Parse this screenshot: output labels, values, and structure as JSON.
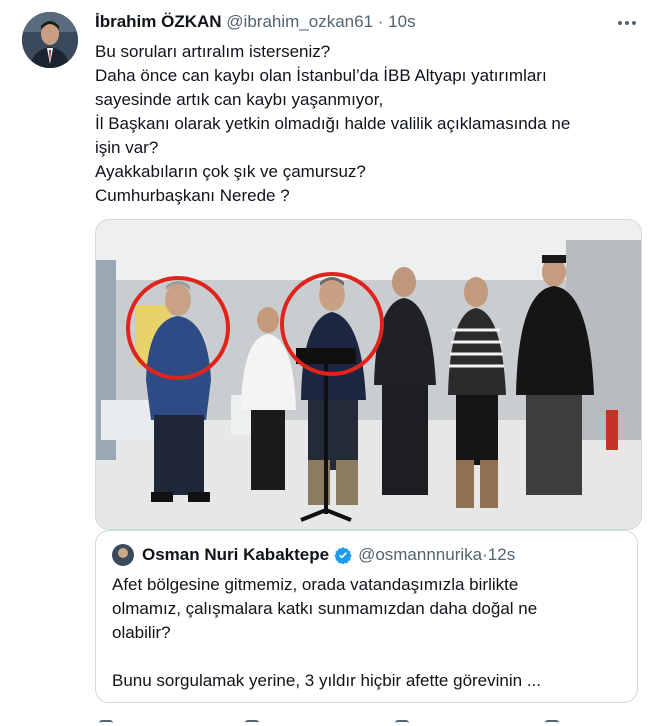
{
  "tweet": {
    "author_name": "İbrahim ÖZKAN",
    "author_handle": "@ibrahim_ozkan61",
    "separator": "·",
    "time": "10s",
    "text_lines": [
      "Bu soruları artıralım isterseniz?",
      "Daha önce can kaybı olan İstanbul’da İBB Altyapı yatırımları",
      "sayesinde artık can kaybı yaşanmıyor,",
      "İl Başkanı olarak yetkin olmadığı halde valilik açıklamasında ne",
      "işin var?",
      "Ayakkabıların çok şık ve çamursuz?",
      "Cumhurbaşkanı Nerede ?"
    ]
  },
  "quoted_tweet": {
    "author_name": "Osman Nuri Kabaktepe",
    "author_handle": "@osmannnurika",
    "separator": "·",
    "time": "12s",
    "verified_color": "#1d9bf0",
    "text_lines": [
      "Afet bölgesine gitmemiz, orada vatandaşımızla birlikte",
      "olmamız, çalışmalara katkı sunmamızdan daha doğal ne",
      "olabilir?",
      "",
      "Bunu sorgulamak yerine, 3 yıldır hiçbir afette görevinin ..."
    ]
  },
  "media": {
    "highlight_color": "#e0241b"
  }
}
